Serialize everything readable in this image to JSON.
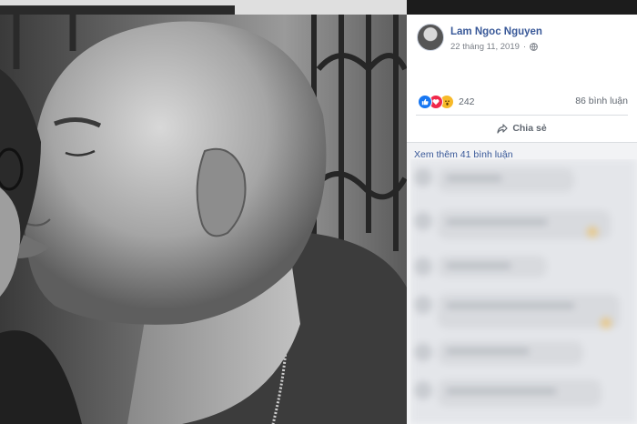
{
  "post": {
    "author": "Lam Ngoc Nguyen",
    "date": "22 tháng 11, 2019",
    "date_separator": "·",
    "reaction_count": "242",
    "comment_count": "86 bình luận",
    "share_label": "Chia sẻ",
    "more_comments": "Xem thêm 41 bình luận"
  },
  "icons": {
    "like": "like-icon",
    "love": "love-icon",
    "wow": "wow-icon",
    "globe": "globe-icon",
    "share": "share-icon"
  },
  "colors": {
    "link_blue": "#385898",
    "like_blue": "#1877f2",
    "love_red": "#f0284a",
    "wow_yellow": "#f7b928",
    "meta_gray": "#606770"
  }
}
